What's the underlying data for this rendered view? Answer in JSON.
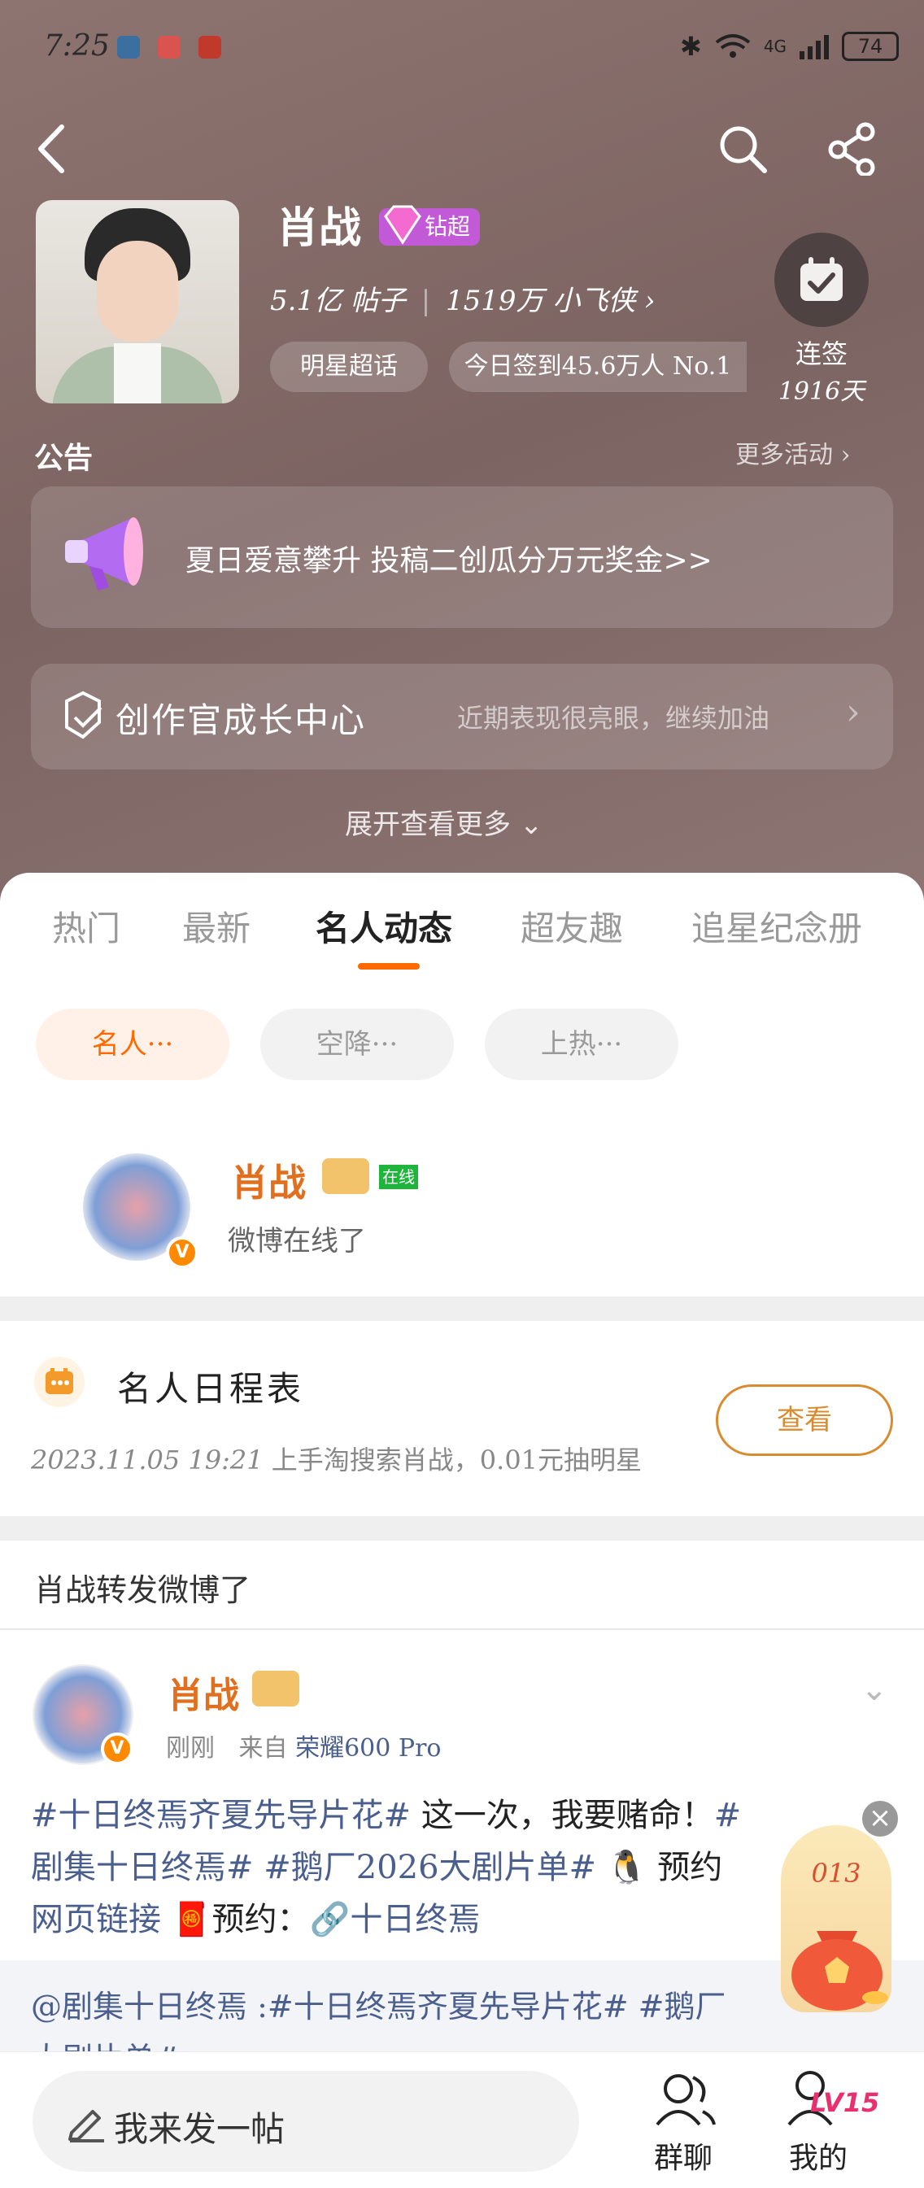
{
  "status_bar": {
    "time": "7:25",
    "network": "4G",
    "battery": "74"
  },
  "profile": {
    "name": "肖战",
    "badge": "钻超",
    "posts": "5.1亿 帖子",
    "fans": "1519万 小飞侠",
    "category_chip": "明星超话",
    "checkin_chip": "今日签到45.6万人 No.1",
    "streak_label": "连签",
    "streak_days": "1916天"
  },
  "announcement": {
    "title": "公告",
    "more": "更多活动",
    "text": "夏日爱意攀升 投稿二创瓜分万元奖金>>"
  },
  "growth": {
    "title": "创作官成长中心",
    "desc": "近期表现很亮眼，继续加油"
  },
  "expand": "展开查看更多",
  "tabs": [
    "热门",
    "最新",
    "名人动态",
    "超友趣",
    "追星纪念册"
  ],
  "filters": [
    "名人···",
    "空降···",
    "上热···"
  ],
  "celebrity": {
    "name": "肖战",
    "online": "在线",
    "status": "微博在线了"
  },
  "schedule": {
    "title": "名人日程表",
    "date": "2023.11.05 19:21",
    "text": "上手淘搜索肖战，0.01元抽明星",
    "button": "查看"
  },
  "repost_header": "肖战转发微博了",
  "post": {
    "author": "肖战",
    "time": "刚刚",
    "from_label": "来自",
    "device": "荣耀600 Pro",
    "line1_tag": "#十日终焉齐夏先导片花#",
    "line1_text": " 这一次，我要赌命！",
    "line1_tag2": "#",
    "line2_tag": "剧集十日终焉#",
    "line2_tag2": " #鹅厂2026大剧片单#",
    "line2_text": " 🐧 预约",
    "line3_link": "网页链接",
    "line3_text": " 🧧预约：",
    "line3_link2": "🔗十日终焉",
    "quote1": "@剧集十日终焉 :#十日终焉齐夏先导片花# #鹅厂",
    "quote2": "大剧片单#"
  },
  "float_widget": {
    "count": "013"
  },
  "bottom_bar": {
    "compose_placeholder": "我来发一帖",
    "group_chat": "群聊",
    "mine": "我的",
    "level": "LV15"
  },
  "colors": {
    "accent": "#ff6a00",
    "gold": "#d98c2f",
    "hashtag": "#4b5f8e"
  }
}
